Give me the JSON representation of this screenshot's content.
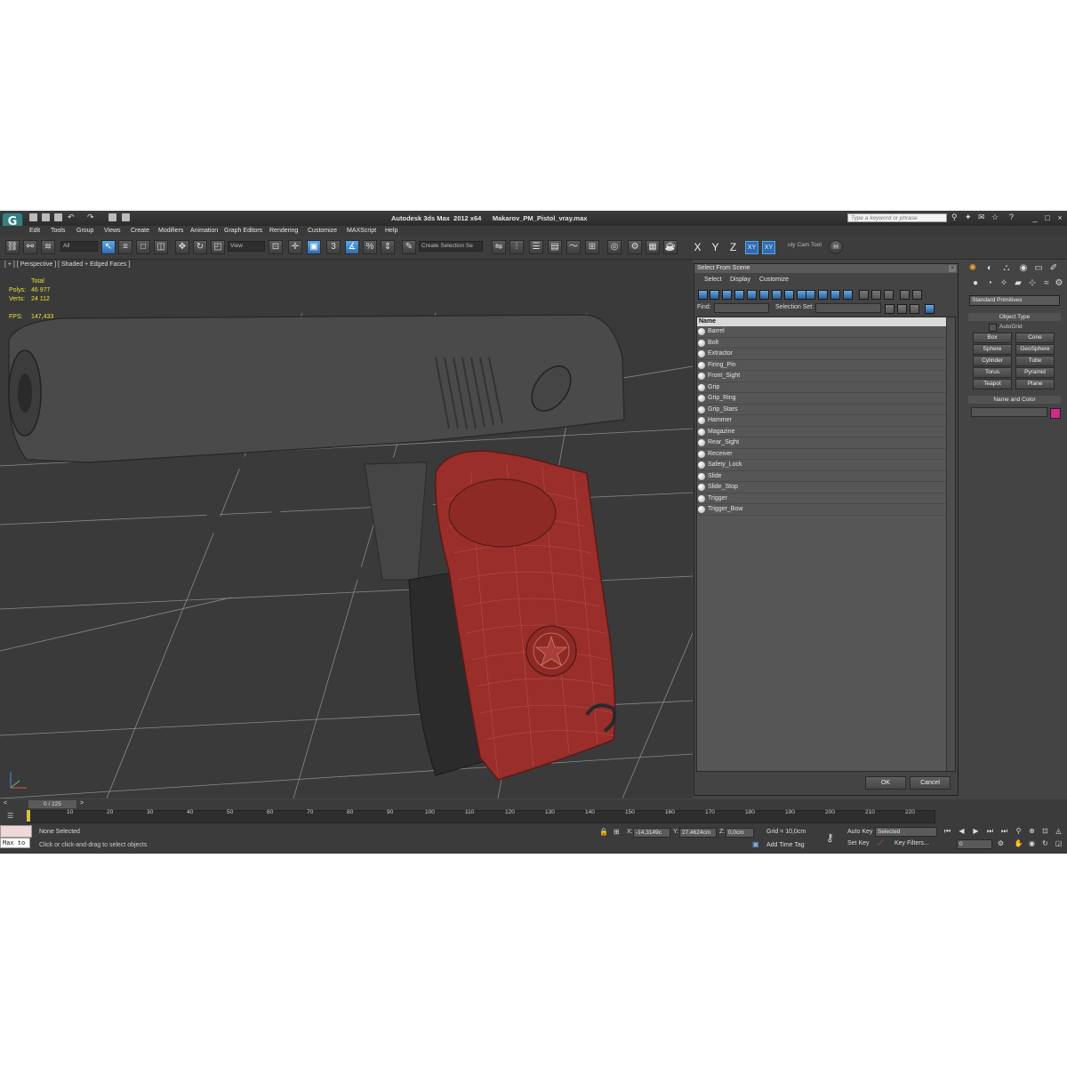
{
  "app": {
    "title_left": "Autodesk 3ds Max  2012 x64",
    "title_file": "Makarov_PM_Pistol_vray.max",
    "search_placeholder": "Type a keyword or phrase"
  },
  "menu": [
    "Edit",
    "Tools",
    "Group",
    "Views",
    "Create",
    "Modifiers",
    "Animation",
    "Graph Editors",
    "Rendering",
    "Customize",
    "MAXScript",
    "Help"
  ],
  "toolbar": {
    "filter": "All",
    "ref_coord": "View",
    "selection_set": "Create Selection Se",
    "snap_3": "3",
    "axes": [
      "X",
      "Y",
      "Z",
      "XY",
      "XY"
    ],
    "utility": "uty Cam Tool"
  },
  "viewport": {
    "label": "[ + ] [ Perspective ] [ Shaded + Edged Faces ]",
    "stats": {
      "total": "Total",
      "polys_label": "Polys:",
      "polys": "46 977",
      "verts_label": "Verts:",
      "verts": "24 112",
      "fps_label": "FPS:",
      "fps": "147,433"
    }
  },
  "dialog": {
    "title": "Select From Scene",
    "menu": [
      "Select",
      "Display",
      "Customize"
    ],
    "find_label": "Find:",
    "selection_set_label": "Selection Set:",
    "column": "Name",
    "objects": [
      "Barrel",
      "Bolt",
      "Extractor",
      "Firing_Pin",
      "Front_Sight",
      "Grip",
      "Grip_Ring",
      "Grip_Stars",
      "Hammer",
      "Magazine",
      "Rear_Sight",
      "Receiver",
      "Safety_Lock",
      "Slide",
      "Slide_Stop",
      "Trigger",
      "Trigger_Bow"
    ],
    "ok": "OK",
    "cancel": "Cancel"
  },
  "command_panel": {
    "dropdown": "Standard Primitives",
    "object_type": "Object Type",
    "autogrid": "AutoGrid",
    "buttons": [
      "Box",
      "Cone",
      "Sphere",
      "GeoSphere",
      "Cylinder",
      "Tube",
      "Torus",
      "Pyramid",
      "Teapot",
      "Plane"
    ],
    "name_color": "Name and Color",
    "color": "#d02a8a"
  },
  "timeline": {
    "frame": "0 / 225",
    "ticks": [
      "10",
      "20",
      "30",
      "40",
      "50",
      "60",
      "70",
      "80",
      "90",
      "100",
      "110",
      "120",
      "130",
      "140",
      "150",
      "160",
      "170",
      "180",
      "190",
      "200",
      "210",
      "220"
    ]
  },
  "status": {
    "maxscript": "Max to",
    "selection": "None Selected",
    "prompt": "Click or click-and-drag to select objects",
    "x_label": "X:",
    "x": "-14,3149c",
    "y_label": "Y:",
    "y": "27,4624cm",
    "z_label": "Z:",
    "z": "0,0cm",
    "grid": "Grid = 10,0cm",
    "add_time_tag": "Add Time Tag",
    "auto_key": "Auto Key",
    "selected": "Selected",
    "set_key": "Set Key",
    "key_filters": "Key Filters...",
    "frame_field": "0"
  }
}
